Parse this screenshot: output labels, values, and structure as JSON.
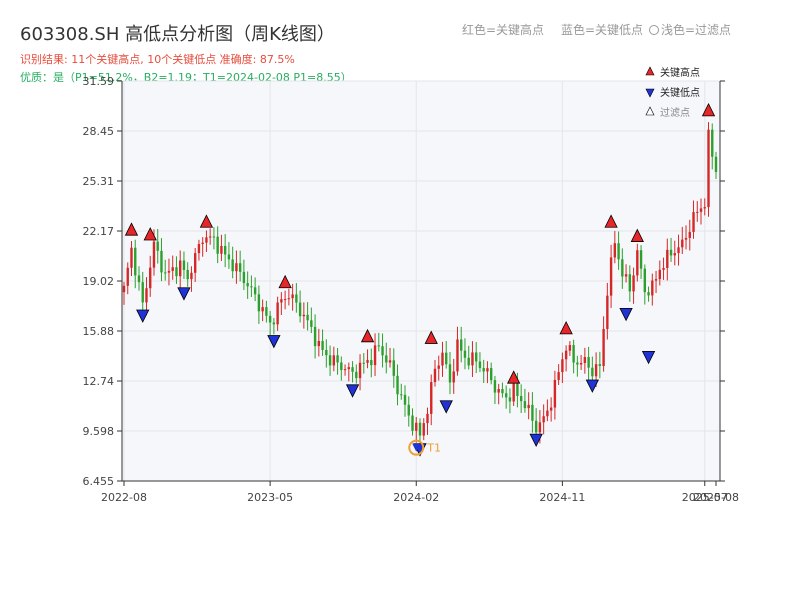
{
  "title": "603308.SH 高低点分析图（周K线图）",
  "summary": {
    "line1": "识别结果: 11个关键高点, 10个关键低点  准确度: 87.5%",
    "line2": "优质：是（P1=51.2%，B2=1.19；T1=2024-02-08 P1=8.55）"
  },
  "top_legend": {
    "red": "红色=关键高点",
    "blue": "蓝色=关键低点",
    "light": "浅色=过滤点"
  },
  "colors": {
    "up": "#d62728",
    "down": "#2ca02c",
    "high_marker": "#e8262a",
    "low_marker": "#1f33d6",
    "t1_marker": "#f0a030",
    "plot_bg": "#f5f7fa"
  },
  "chart_data": {
    "type": "candlestick",
    "title": "603308.SH 高低点分析图（周K线图）",
    "y_ticks": [
      "31.59",
      "28.45",
      "25.31",
      "22.17",
      "19.02",
      "15.88",
      "12.74",
      "9.598",
      "6.455"
    ],
    "ylim": [
      6.455,
      31.59
    ],
    "x_ticks": [
      "2022-08",
      "2023-05",
      "2024-02",
      "2024-11",
      "2025-07",
      "2025-08"
    ],
    "x_tick_index": [
      0,
      39,
      78,
      117,
      155,
      158
    ],
    "xlim": [
      0,
      158
    ],
    "legend": {
      "position": "top-right",
      "items": [
        {
          "label": "关键高点",
          "symbol": "red-up-triangle"
        },
        {
          "label": "关键低点",
          "symbol": "blue-down-triangle"
        },
        {
          "label": "过滤点",
          "symbol": "open-triangle"
        }
      ]
    },
    "anchors": [
      [
        0,
        18.5
      ],
      [
        2,
        21.0
      ],
      [
        5,
        17.5
      ],
      [
        8,
        21.3
      ],
      [
        11,
        19.4
      ],
      [
        15,
        20.0
      ],
      [
        17,
        19.2
      ],
      [
        21,
        21.8
      ],
      [
        24,
        21.6
      ],
      [
        27,
        20.6
      ],
      [
        30,
        19.8
      ],
      [
        33,
        18.8
      ],
      [
        36,
        17.6
      ],
      [
        39,
        16.3
      ],
      [
        42,
        17.8
      ],
      [
        44,
        18.2
      ],
      [
        47,
        17.2
      ],
      [
        50,
        16.0
      ],
      [
        52,
        14.9
      ],
      [
        55,
        14.1
      ],
      [
        58,
        13.7
      ],
      [
        61,
        13.2
      ],
      [
        64,
        13.8
      ],
      [
        66,
        14.2
      ],
      [
        68,
        14.9
      ],
      [
        71,
        13.7
      ],
      [
        73,
        12.3
      ],
      [
        76,
        10.5
      ],
      [
        79,
        9.3
      ],
      [
        81,
        11.0
      ],
      [
        83,
        13.5
      ],
      [
        85,
        14.5
      ],
      [
        87,
        12.6
      ],
      [
        89,
        15.0
      ],
      [
        91,
        14.2
      ],
      [
        94,
        14.0
      ],
      [
        97,
        13.2
      ],
      [
        100,
        12.0
      ],
      [
        102,
        11.7
      ],
      [
        104,
        12.1
      ],
      [
        107,
        11.3
      ],
      [
        110,
        9.8
      ],
      [
        112,
        10.3
      ],
      [
        114,
        11.5
      ],
      [
        116,
        13.3
      ],
      [
        118,
        15.0
      ],
      [
        120,
        14.0
      ],
      [
        123,
        13.9
      ],
      [
        125,
        13.4
      ],
      [
        127,
        13.6
      ],
      [
        129,
        18.5
      ],
      [
        131,
        21.5
      ],
      [
        133,
        19.5
      ],
      [
        135,
        18.5
      ],
      [
        137,
        20.8
      ],
      [
        139,
        18.4
      ],
      [
        141,
        18.6
      ],
      [
        143,
        19.8
      ],
      [
        146,
        20.8
      ],
      [
        149,
        21.3
      ],
      [
        152,
        23.0
      ],
      [
        155,
        24.0
      ],
      [
        156,
        28.0
      ],
      [
        158,
        26.0
      ]
    ],
    "key_highs": [
      {
        "i": 2,
        "price": 21.9
      },
      {
        "i": 7,
        "price": 21.6
      },
      {
        "i": 22,
        "price": 22.4
      },
      {
        "i": 43,
        "price": 18.6
      },
      {
        "i": 65,
        "price": 15.2
      },
      {
        "i": 82,
        "price": 15.1
      },
      {
        "i": 104,
        "price": 12.6
      },
      {
        "i": 118,
        "price": 15.7
      },
      {
        "i": 130,
        "price": 22.4
      },
      {
        "i": 137,
        "price": 21.5
      },
      {
        "i": 156,
        "price": 29.4
      }
    ],
    "key_lows": [
      {
        "i": 5,
        "price": 17.2
      },
      {
        "i": 16,
        "price": 18.6
      },
      {
        "i": 40,
        "price": 15.6
      },
      {
        "i": 61,
        "price": 12.5
      },
      {
        "i": 79,
        "price": 8.8
      },
      {
        "i": 86,
        "price": 11.5
      },
      {
        "i": 110,
        "price": 9.4
      },
      {
        "i": 125,
        "price": 12.8
      },
      {
        "i": 134,
        "price": 17.3
      },
      {
        "i": 140,
        "price": 14.6
      }
    ],
    "t1_marker": {
      "i": 78,
      "price": 8.55,
      "label": "T1"
    }
  }
}
